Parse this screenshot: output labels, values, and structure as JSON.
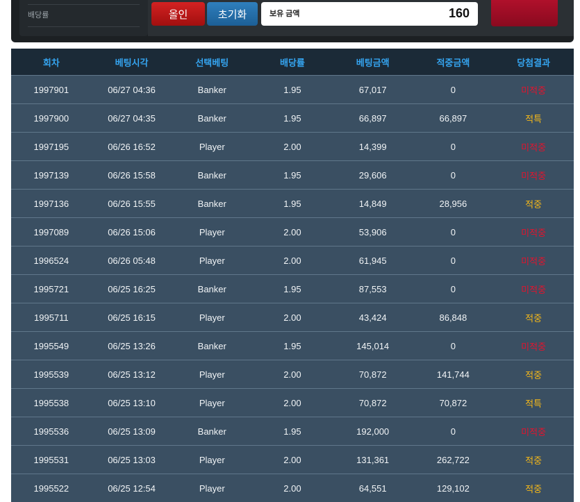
{
  "panel": {
    "odds_label": "배당률",
    "allin_label": "올인",
    "reset_label": "초기화",
    "balance_label": "보유 금액",
    "balance_value": "160"
  },
  "colors": {
    "header_bg": "#1b2a37",
    "header_text": "#35a4ef",
    "row_bg": "#3a4f62",
    "lose": "#e3132d",
    "win": "#f5b819"
  },
  "table": {
    "headers": [
      "회차",
      "베팅시각",
      "선택베팅",
      "배당률",
      "베팅금액",
      "적중금액",
      "당첨결과"
    ],
    "rows": [
      {
        "round": "1997901",
        "time": "06/27 04:36",
        "pick": "Banker",
        "odds": "1.95",
        "bet": "67,017",
        "payout": "0",
        "result": "미적중",
        "status": "lose"
      },
      {
        "round": "1997900",
        "time": "06/27 04:35",
        "pick": "Banker",
        "odds": "1.95",
        "bet": "66,897",
        "payout": "66,897",
        "result": "적특",
        "status": "win"
      },
      {
        "round": "1997195",
        "time": "06/26 16:52",
        "pick": "Player",
        "odds": "2.00",
        "bet": "14,399",
        "payout": "0",
        "result": "미적중",
        "status": "lose"
      },
      {
        "round": "1997139",
        "time": "06/26 15:58",
        "pick": "Banker",
        "odds": "1.95",
        "bet": "29,606",
        "payout": "0",
        "result": "미적중",
        "status": "lose"
      },
      {
        "round": "1997136",
        "time": "06/26 15:55",
        "pick": "Banker",
        "odds": "1.95",
        "bet": "14,849",
        "payout": "28,956",
        "result": "적중",
        "status": "win"
      },
      {
        "round": "1997089",
        "time": "06/26 15:06",
        "pick": "Player",
        "odds": "2.00",
        "bet": "53,906",
        "payout": "0",
        "result": "미적중",
        "status": "lose"
      },
      {
        "round": "1996524",
        "time": "06/26 05:48",
        "pick": "Player",
        "odds": "2.00",
        "bet": "61,945",
        "payout": "0",
        "result": "미적중",
        "status": "lose"
      },
      {
        "round": "1995721",
        "time": "06/25 16:25",
        "pick": "Banker",
        "odds": "1.95",
        "bet": "87,553",
        "payout": "0",
        "result": "미적중",
        "status": "lose"
      },
      {
        "round": "1995711",
        "time": "06/25 16:15",
        "pick": "Player",
        "odds": "2.00",
        "bet": "43,424",
        "payout": "86,848",
        "result": "적중",
        "status": "win"
      },
      {
        "round": "1995549",
        "time": "06/25 13:26",
        "pick": "Banker",
        "odds": "1.95",
        "bet": "145,014",
        "payout": "0",
        "result": "미적중",
        "status": "lose"
      },
      {
        "round": "1995539",
        "time": "06/25 13:12",
        "pick": "Player",
        "odds": "2.00",
        "bet": "70,872",
        "payout": "141,744",
        "result": "적중",
        "status": "win"
      },
      {
        "round": "1995538",
        "time": "06/25 13:10",
        "pick": "Player",
        "odds": "2.00",
        "bet": "70,872",
        "payout": "70,872",
        "result": "적특",
        "status": "win"
      },
      {
        "round": "1995536",
        "time": "06/25 13:09",
        "pick": "Banker",
        "odds": "1.95",
        "bet": "192,000",
        "payout": "0",
        "result": "미적중",
        "status": "lose"
      },
      {
        "round": "1995531",
        "time": "06/25 13:03",
        "pick": "Player",
        "odds": "2.00",
        "bet": "131,361",
        "payout": "262,722",
        "result": "적중",
        "status": "win"
      },
      {
        "round": "1995522",
        "time": "06/25 12:54",
        "pick": "Player",
        "odds": "2.00",
        "bet": "64,551",
        "payout": "129,102",
        "result": "적중",
        "status": "win"
      }
    ]
  }
}
